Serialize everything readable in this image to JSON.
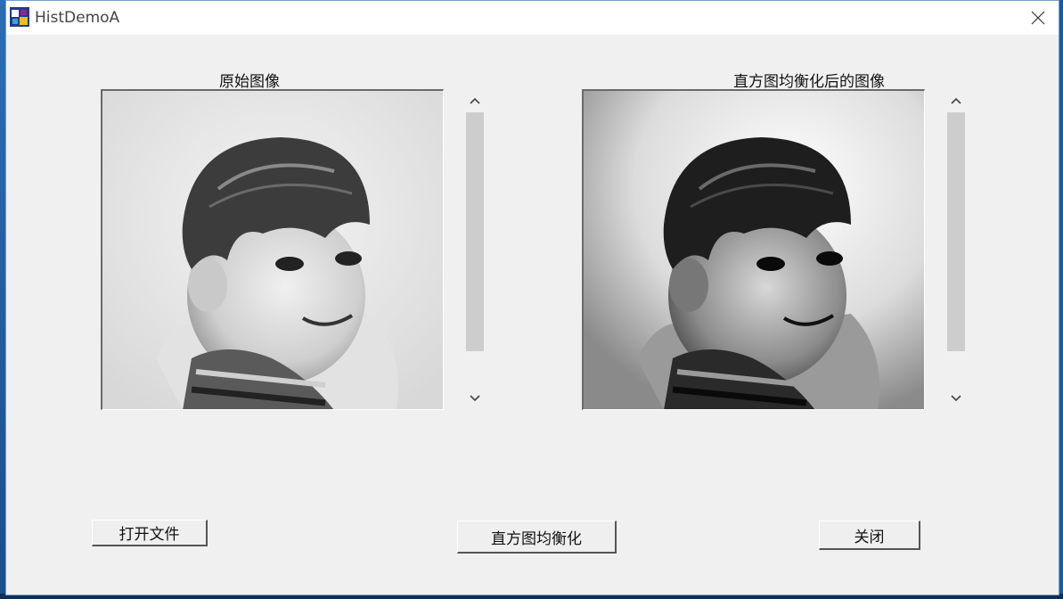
{
  "window": {
    "title": "HistDemoA"
  },
  "left_panel": {
    "label": "原始图像"
  },
  "right_panel": {
    "label": "直方图均衡化后的图像"
  },
  "buttons": {
    "open_file": "打开文件",
    "equalize": "直方图均衡化",
    "close": "关闭"
  },
  "icons": {
    "app": "app-icon",
    "close": "close-icon",
    "scroll_up": "chevron-up-icon",
    "scroll_down": "chevron-down-icon"
  }
}
